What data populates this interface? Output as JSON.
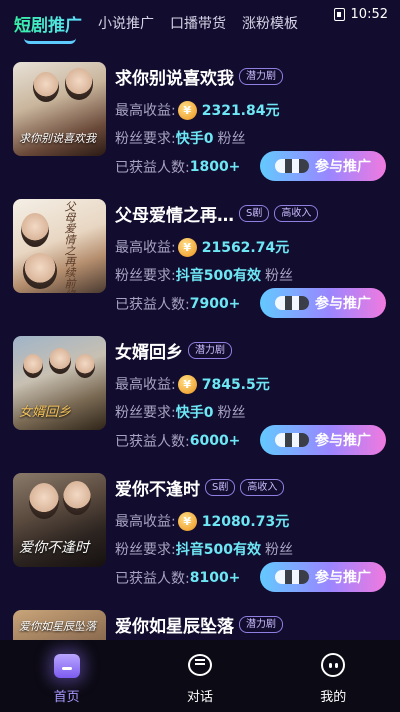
{
  "status_bar": {
    "time": "10:52"
  },
  "tabs": [
    {
      "label": "短剧推广",
      "active": true
    },
    {
      "label": "小说推广",
      "active": false
    },
    {
      "label": "口播带货",
      "active": false
    },
    {
      "label": "涨粉模板",
      "active": false
    }
  ],
  "labels": {
    "max_income": "最高收益:",
    "fans_req": "粉丝要求:",
    "fans_suffix": "粉丝",
    "earners": "已获益人数:",
    "promote": "参与推广",
    "coin": "¥"
  },
  "dramas": [
    {
      "title": "求你别说喜欢我",
      "poster_text": "求你别说喜欢我",
      "tags": [
        "潜力剧"
      ],
      "max_income": "2321.84元",
      "fans_req": "快手0",
      "earners": "1800+"
    },
    {
      "title": "父母爱情之再…",
      "poster_text": "父母爱情之再续前缘",
      "tags": [
        "S剧",
        "高收入"
      ],
      "max_income": "21562.74元",
      "fans_req": "抖音500有效",
      "earners": "7900+"
    },
    {
      "title": "女婿回乡",
      "poster_text": "女婿回乡",
      "tags": [
        "潜力剧"
      ],
      "max_income": "7845.5元",
      "fans_req": "快手0",
      "earners": "6000+"
    },
    {
      "title": "爱你不逢时",
      "poster_text": "爱你不逢时",
      "tags": [
        "S剧",
        "高收入"
      ],
      "max_income": "12080.73元",
      "fans_req": "抖音500有效",
      "earners": "8100+"
    },
    {
      "title": "爱你如星辰坠落",
      "poster_text": "爱你如星辰坠落",
      "tags": [
        "潜力剧"
      ],
      "max_income": "",
      "fans_req": "",
      "earners": ""
    }
  ],
  "bottom_nav": [
    {
      "label": "首页",
      "icon": "home-icon",
      "active": true
    },
    {
      "label": "对话",
      "icon": "chat-icon",
      "active": false
    },
    {
      "label": "我的",
      "icon": "profile-icon",
      "active": false
    }
  ],
  "colors": {
    "background": "#120c2e",
    "accent": "#6ee7f5",
    "tab_active": "#35f0a4"
  }
}
